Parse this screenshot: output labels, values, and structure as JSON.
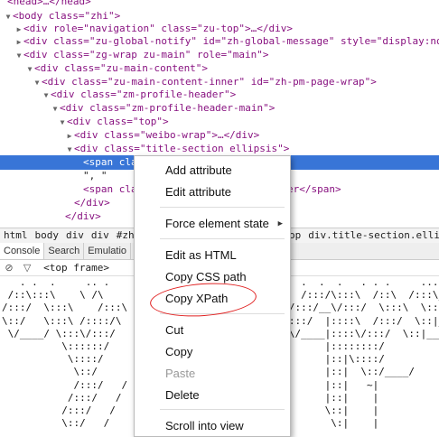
{
  "tree": {
    "lines": [
      {
        "tri": "",
        "text": "<head>…</head>",
        "cut": true
      },
      {
        "tri": "▼",
        "text": "<body class=\"zhi\">"
      },
      {
        "tri": "▶",
        "text": "<div role=\"navigation\" class=\"zu-top\">…</div>"
      },
      {
        "tri": "▶",
        "text": "<div class=\"zu-global-notify\" id=\"zh-global-message\" style=\"display:no"
      },
      {
        "tri": "▼",
        "text": "<div class=\"zg-wrap zu-main\" role=\"main\">"
      },
      {
        "tri": "▼",
        "text": "<div class=\"zu-main-content\">"
      },
      {
        "tri": "▼",
        "text": "<div class=\"zu-main-content-inner\" id=\"zh-pm-page-wrap\">"
      },
      {
        "tri": "▼",
        "text": "<div class=\"zm-profile-header\">"
      },
      {
        "tri": "▼",
        "text": "<div class=\"zm-profile-header-main\">"
      },
      {
        "tri": "▼",
        "text": "<div class=\"top\">"
      },
      {
        "tri": "▶",
        "text": "<div class=\"weibo-wrap\">…</div>"
      },
      {
        "tri": "▼",
        "text": "<div class=\"title-section ellipsis\">"
      },
      {
        "tri": "",
        "text": "<span cla"
      },
      {
        "tri": "",
        "text": "\", \""
      },
      {
        "tri": "",
        "text": "<span cla"
      },
      {
        "tri": "",
        "text": "</div>"
      },
      {
        "tri": "",
        "text": "</div>"
      }
    ],
    "tail_text": "er</span>"
  },
  "breadcrumbs": {
    "items": [
      "html",
      "body",
      "div",
      "div",
      "#zh"
    ],
    "right_items": [
      "op",
      "div.title-section.ellipsis"
    ],
    "selected": "spa"
  },
  "tabs": [
    "Console",
    "Search",
    "Emulatio"
  ],
  "console": {
    "frame_label": "<top frame>",
    "ascii": [
      "   . .  .     .. .                                .  .  .   . . .     ....    ",
      " /::\\:::\\    \\ /\\                              \\  /:::/\\:::\\  /::\\  /:::\\__ ",
      "/:::/  \\:::\\    /:::\\                           /:::/__\\/:::/  \\:::\\  \\:::|  ",
      "\\::/   \\:::\\ /::::/\\                          /\\:::/  |::::\\  /:::/  \\::|_ ",
      " \\/____/ \\:::\\/:::/                          _/ \\/____|::::\\/:::/  \\::|___",
      "          \\::::::/                                    |::::::::/       ",
      "           \\::::/                                     |::|\\::::/       ",
      "            \\::/                                      |::|  \\::/____/  ",
      "            /:::/   /                                 |::|   ~|       ",
      "           /:::/   /                                  |::|    |       ",
      "          /:::/   /                                   \\::|    |       ",
      "          \\::/   /                                     \\:|    |       ",
      "           \\/   /                                       \\|    |       "
    ]
  },
  "context_menu": {
    "items": [
      {
        "label": "Add attribute",
        "disabled": false
      },
      {
        "label": "Edit attribute",
        "disabled": false
      },
      {
        "label": "Force element state",
        "disabled": false,
        "submenu": true
      },
      {
        "label": "Edit as HTML",
        "disabled": false
      },
      {
        "label": "Copy CSS path",
        "disabled": false
      },
      {
        "label": "Copy XPath",
        "disabled": false,
        "highlighted": true
      },
      {
        "label": "Cut",
        "disabled": false
      },
      {
        "label": "Copy",
        "disabled": false
      },
      {
        "label": "Paste",
        "disabled": true
      },
      {
        "label": "Delete",
        "disabled": false
      },
      {
        "label": "Scroll into view",
        "disabled": false
      }
    ]
  },
  "colors": {
    "selection": "#3875d7",
    "tag": "#881280",
    "highlight_circle": "#e02020"
  }
}
